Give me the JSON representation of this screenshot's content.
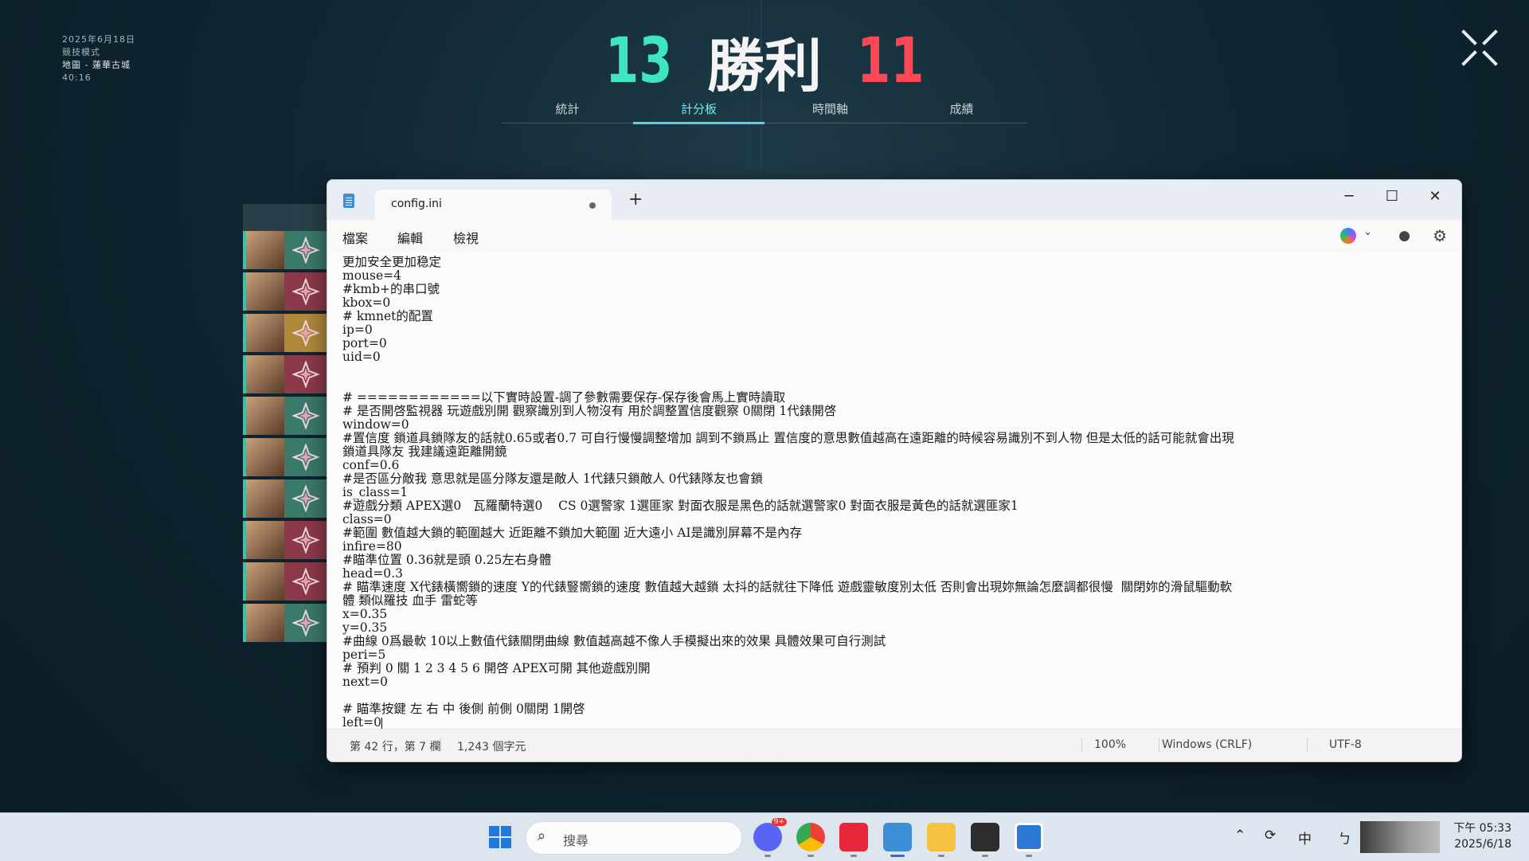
{
  "match": {
    "date": "2025年6月18日",
    "mode": "競技模式",
    "map": "地圖 - 蓮華古城",
    "duration": "40:16",
    "score_left": "13",
    "result": "勝利",
    "score_right": "11",
    "tabs": [
      "統計",
      "計分板",
      "時間軸",
      "成績"
    ],
    "active_tab": 1
  },
  "notepad": {
    "tab_title": "config.ini",
    "menu": [
      "檔案",
      "編輯",
      "檢視"
    ],
    "lines": [
      "更加安全更加稳定",
      "mouse=4",
      "#kmb+的串口號",
      "kbox=0",
      "# kmnet的配置",
      "ip=0",
      "port=0",
      "uid=0",
      "",
      "",
      "# ============以下實時設置-調了參數需要保存-保存後會馬上實時讀取",
      "# 是否開啓監視器 玩遊戲別開 觀察識別到人物沒有 用於調整置信度觀察 0關閉 1代錶開啓",
      "window=0",
      "#置信度 鎖道具鎖隊友的話就0.65或者0.7 可自行慢慢調整增加 調到不鎖爲止 置信度的意思數值越高在遠距離的時候容易識別不到人物 但是太低的話可能就會出現",
      "鎖道具隊友 我建議遠距離開鏡",
      "conf=0.6",
      "#是否區分敵我 意思就是區分隊友還是敵人 1代錶只鎖敵人 0代錶隊友也會鎖",
      "is_class=1",
      "#遊戲分類 APEX選0   瓦羅蘭特選0    CS 0選警家 1選匪家 對面衣服是黑色的話就選警家0 對面衣服是黃色的話就選匪家1",
      "class=0",
      "#範圍 數值越大鎖的範圍越大 近距離不鎖加大範圍 近大遠小 AI是識別屏幕不是內存",
      "infire=80",
      "#瞄準位置 0.36就是頭 0.25左右身體",
      "head=0.3",
      "# 瞄準速度 X代錶橫嚮鎖的速度 Y的代錶豎嚮鎖的速度 數值越大越鎖 太抖的話就往下降低 遊戲靈敏度別太低 否則會出現妳無論怎麼調都很慢  關閉妳的滑鼠驅動軟",
      "體 類似羅技 血手 雷蛇等",
      "x=0.35",
      "y=0.35",
      "#曲線 0爲最軟 10以上數值代錶關閉曲線 數值越高越不像人手模擬出來的效果 具體效果可自行測試",
      "peri=5",
      "# 預判 0 關 1 2 3 4 5 6 開啓 APEX可開 其他遊戲別開",
      "next=0",
      "",
      "# 瞄準按鍵 左 右 中 後側 前側 0關閉 1開啓",
      "left=0"
    ],
    "status": {
      "position": "第 42 行，第 7 欄",
      "chars": "1,243 個字元",
      "zoom": "100%",
      "line_ending": "Windows (CRLF)",
      "encoding": "UTF-8"
    }
  },
  "taskbar": {
    "search_placeholder": "搜尋",
    "ime": "中",
    "time": "下午 05:33",
    "date": "2025/6/18",
    "discord_badge": "9+"
  },
  "roster_colors": [
    "#3a7a6a",
    "#8c3a4a",
    "#b08a3a",
    "#8c3a4a",
    "#3a7a6a",
    "#3a7a6a",
    "#3a7a6a",
    "#8c3a4a",
    "#8c3a4a",
    "#3a7a6a"
  ]
}
